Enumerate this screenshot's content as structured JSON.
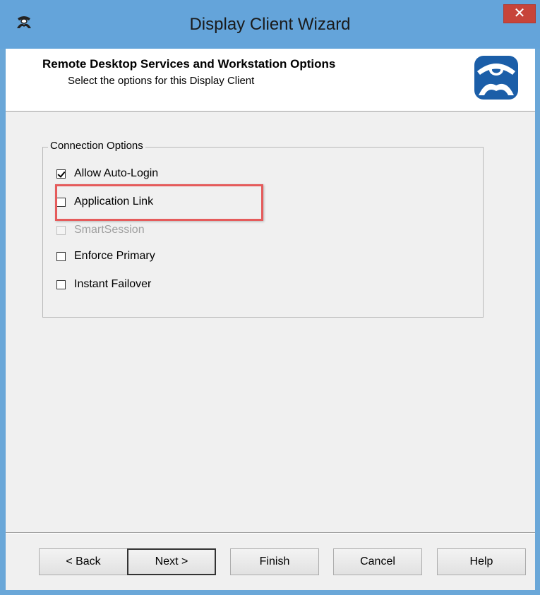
{
  "window": {
    "title": "Display Client Wizard",
    "close_glyph": "✕",
    "icon": "wizard-app-icon",
    "accent_color": "#64a4da",
    "close_color": "#c7443a"
  },
  "header": {
    "title": "Remote Desktop Services and Workstation Options",
    "subtitle": "Select the options for this Display Client",
    "logo": "thinmanager-logo-icon",
    "logo_color": "#1b5ea8"
  },
  "group": {
    "legend": "Connection Options",
    "options": [
      {
        "label": "Allow Auto-Login",
        "checked": true,
        "enabled": true
      },
      {
        "label": "Application Link",
        "checked": false,
        "enabled": true
      },
      {
        "label": "SmartSession",
        "checked": false,
        "enabled": false
      },
      {
        "label": "Enforce Primary",
        "checked": false,
        "enabled": true
      },
      {
        "label": "Instant Failover",
        "checked": false,
        "enabled": true
      }
    ]
  },
  "annotation": {
    "highlight_target": "Application Link",
    "color": "#e55b5b"
  },
  "buttons": {
    "back": "< Back",
    "next": "Next >",
    "finish": "Finish",
    "cancel": "Cancel",
    "help": "Help"
  }
}
